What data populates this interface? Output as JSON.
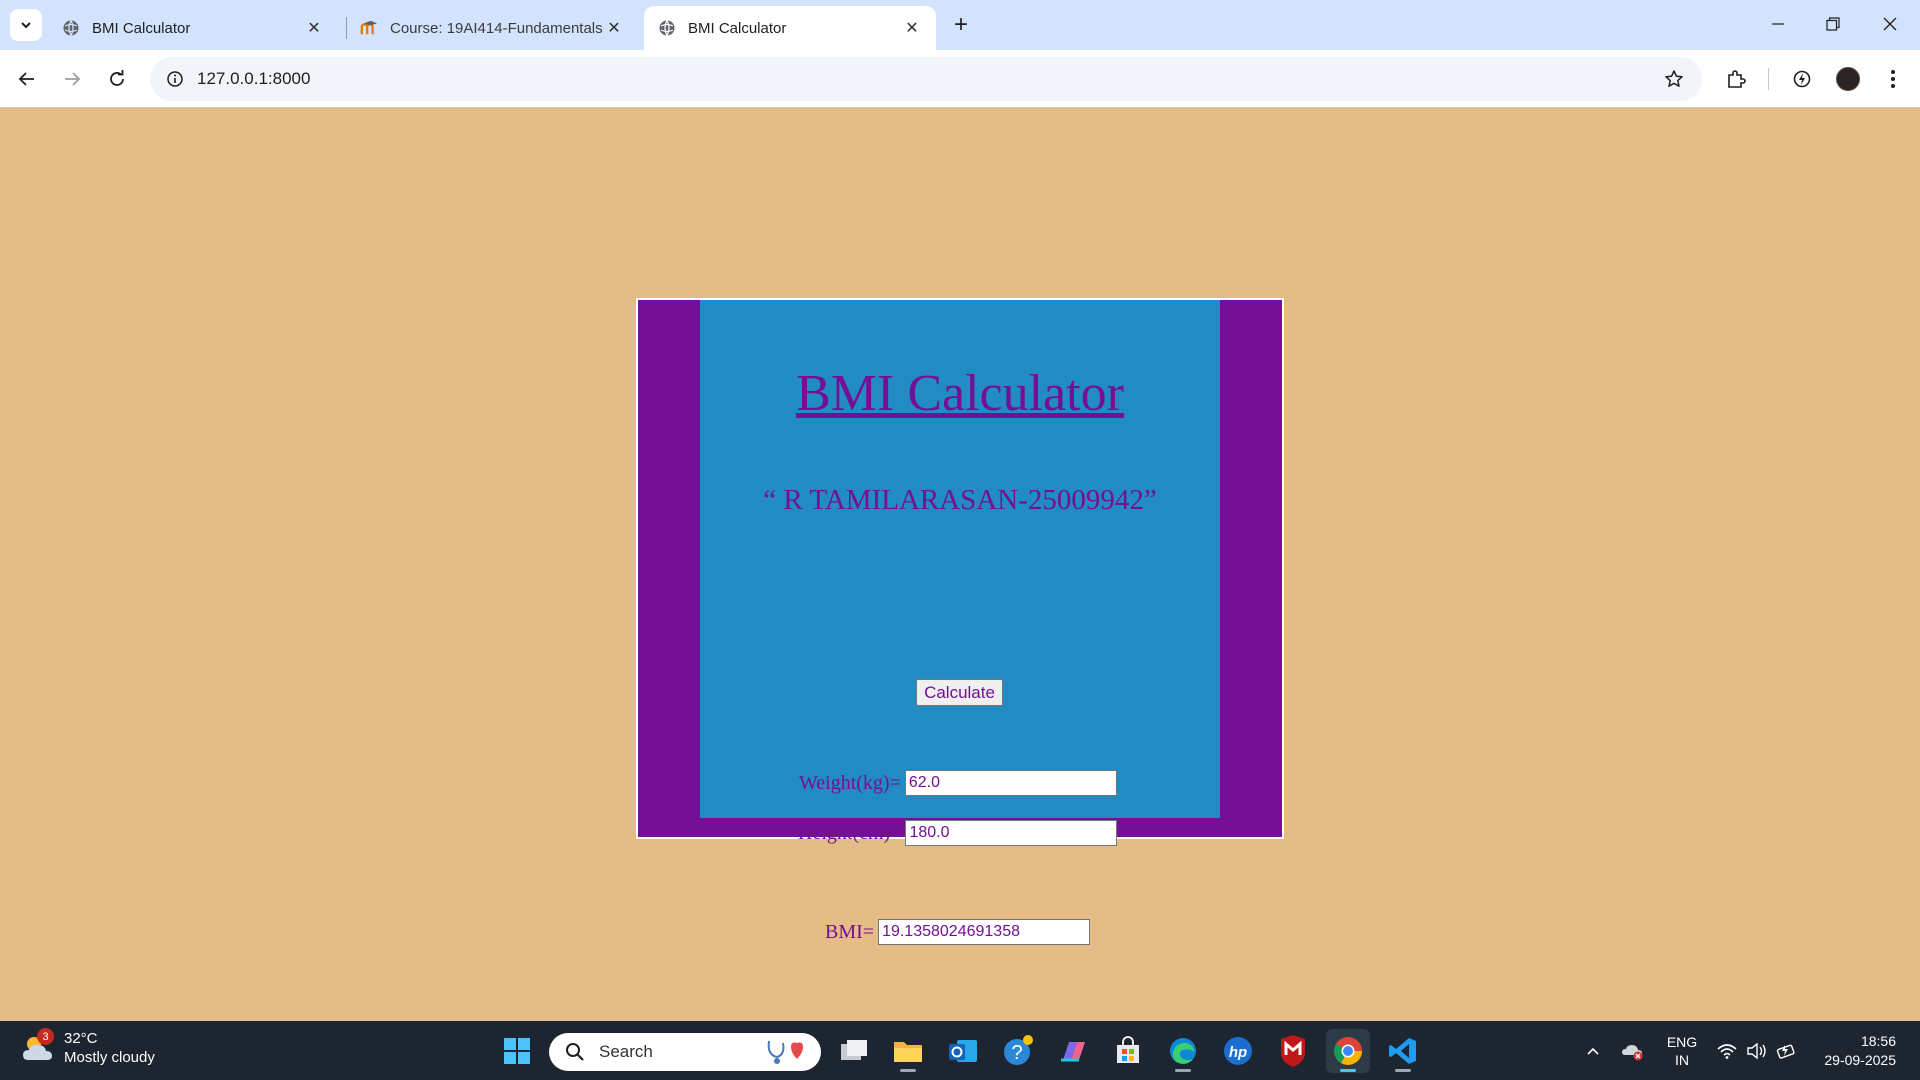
{
  "browser": {
    "tabs": [
      {
        "title": "BMI Calculator",
        "favicon": "globe-icon",
        "active": false
      },
      {
        "title": "Course: 19AI414-Fundamentals",
        "favicon": "moodle-icon",
        "active": false
      },
      {
        "title": "BMI Calculator",
        "favicon": "globe-icon",
        "active": true
      }
    ],
    "url": "127.0.0.1:8000"
  },
  "page": {
    "title": "BMI Calculator",
    "student": "“ R TAMILARASAN-25009942”",
    "weight_label": "Weight(kg)=",
    "weight_value": "62.0",
    "height_label": "Height(cm)=",
    "height_value": "180.0",
    "calculate_label": "Calculate",
    "bmi_label": "BMI=",
    "bmi_value": "19.1358024691358",
    "colors": {
      "background": "#e3bc86",
      "outer": "#740f96",
      "inner": "#228bc1",
      "text": "#740f96"
    }
  },
  "taskbar": {
    "weather": {
      "temp": "32°C",
      "condition": "Mostly cloudy",
      "badge": "3"
    },
    "search_label": "Search",
    "lang_line1": "ENG",
    "lang_line2": "IN",
    "time": "18:56",
    "date": "29-09-2025",
    "apps": [
      "task-view",
      "file-explorer",
      "outlook",
      "help",
      "copilot",
      "microsoft-store",
      "edge",
      "hp",
      "mcafee",
      "chrome",
      "vscode"
    ]
  }
}
